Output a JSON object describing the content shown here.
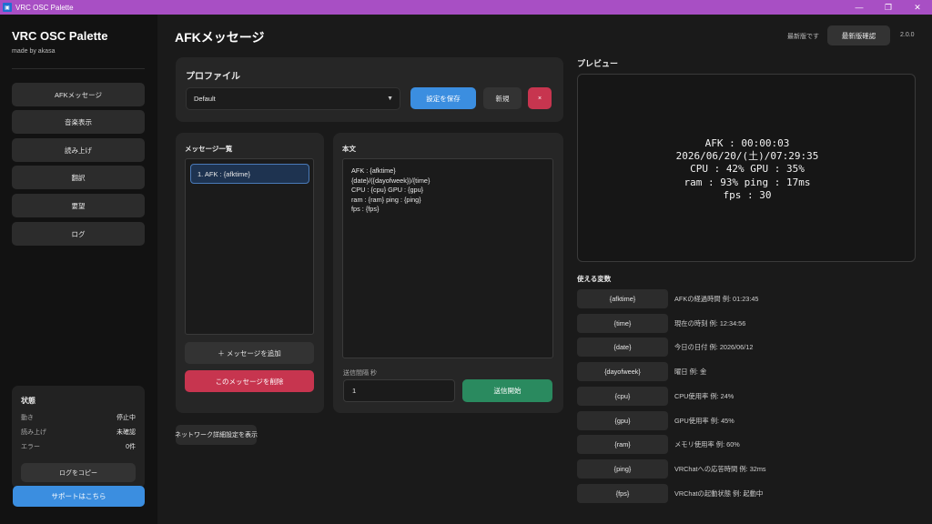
{
  "window": {
    "title": "VRC OSC Palette",
    "controls": [
      "—",
      "❐",
      "✕"
    ]
  },
  "sidebar": {
    "brand": "VRC OSC Palette",
    "author": "made by akasa",
    "nav": [
      "AFKメッセージ",
      "音楽表示",
      "読み上げ",
      "翻訳",
      "要望",
      "ログ"
    ],
    "status": {
      "title": "状態",
      "rows": [
        {
          "key": "動き",
          "value": "停止中"
        },
        {
          "key": "読み上げ",
          "value": "未確認"
        },
        {
          "key": "エラー",
          "value": "0件"
        }
      ],
      "copy_log": "ログをコピー"
    },
    "support": "サポートはこちら"
  },
  "header": {
    "title": "AFKメッセージ",
    "update_status": "最新版です",
    "check_button": "最新版確認",
    "version": "2.0.0"
  },
  "profile": {
    "title": "プロファイル",
    "selected": "Default",
    "save": "設定を保存",
    "new": "新規",
    "delete": "×"
  },
  "message_list": {
    "title": "メッセージ一覧",
    "items": [
      "1. AFK : {afktime}"
    ],
    "add": "＋ メッセージを追加",
    "delete": "このメッセージを削除"
  },
  "body": {
    "title": "本文",
    "text": "AFK : {afktime}\n{date}/({dayofweek})/{time}\nCPU : {cpu} GPU : {gpu}\nram : {ram} ping : {ping}\nfps : {fps}",
    "interval_label": "送信間隔 秒",
    "interval_value": "1",
    "send": "送信開始"
  },
  "network_button": "ネットワーク詳細設定を表示",
  "preview": {
    "title": "プレビュー",
    "text": "AFK : 00:00:03\n2026/06/20/(土)/07:29:35\nCPU : 42% GPU : 35%\nram : 93% ping : 17ms\nfps : 30"
  },
  "variables": {
    "title": "使える変数",
    "items": [
      {
        "name": "{afktime}",
        "desc": "AFKの経過時間 例: 01:23:45"
      },
      {
        "name": "{time}",
        "desc": "現在の時刻 例: 12:34:56"
      },
      {
        "name": "{date}",
        "desc": "今日の日付 例: 2026/06/12"
      },
      {
        "name": "{dayofweek}",
        "desc": "曜日 例: 金"
      },
      {
        "name": "{cpu}",
        "desc": "CPU使用率 例: 24%"
      },
      {
        "name": "{gpu}",
        "desc": "GPU使用率 例: 45%"
      },
      {
        "name": "{ram}",
        "desc": "メモリ使用率 例: 60%"
      },
      {
        "name": "{ping}",
        "desc": "VRChatへの応答時間 例: 32ms"
      },
      {
        "name": "{fps}",
        "desc": "VRChatの起動状態 例: 起動中"
      }
    ]
  },
  "colors": {
    "titlebar": "#a84fc4",
    "accent_blue": "#3b8ee0",
    "danger": "#c7354f",
    "success": "#2a8a5f"
  }
}
